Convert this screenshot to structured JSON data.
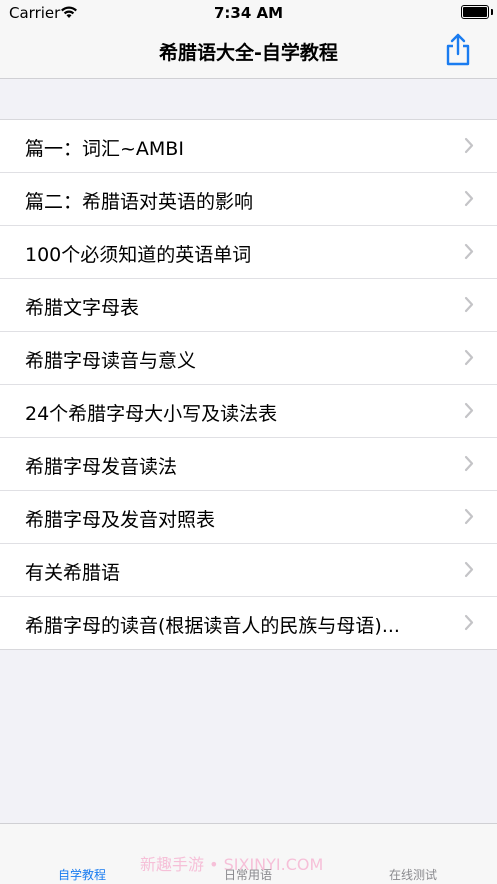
{
  "status_bar": {
    "carrier": "Carrier",
    "time": "7:34 AM"
  },
  "nav": {
    "title": "希腊语大全-自学教程",
    "share_icon": "share-icon"
  },
  "list": {
    "items": [
      {
        "label": "篇一：词汇~AMBI"
      },
      {
        "label": "篇二：希腊语对英语的影响"
      },
      {
        "label": "100个必须知道的英语单词"
      },
      {
        "label": "希腊文字母表"
      },
      {
        "label": "希腊字母读音与意义"
      },
      {
        "label": "24个希腊字母大小写及读法表"
      },
      {
        "label": "希腊字母发音读法"
      },
      {
        "label": "希腊字母及发音对照表"
      },
      {
        "label": "有关希腊语"
      },
      {
        "label": "希腊字母的读音(根据读音人的民族与母语)..."
      }
    ]
  },
  "tab_bar": {
    "tabs": [
      {
        "label": "自学教程",
        "active": true
      },
      {
        "label": "日常用语",
        "active": false
      },
      {
        "label": "在线测试",
        "active": false
      }
    ],
    "watermark": "新趣手游 • SIXINYI.COM"
  },
  "colors": {
    "accent": "#1a7cf0",
    "background": "#f2f2f7",
    "chevron": "#c4c4c7"
  }
}
